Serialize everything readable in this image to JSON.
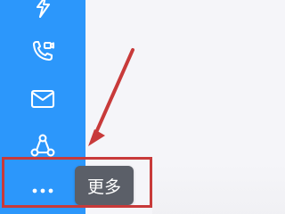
{
  "sidebar": {
    "background": "#2c97fb",
    "items": [
      {
        "icon": "power-icon"
      },
      {
        "icon": "video-call-icon"
      },
      {
        "icon": "mail-icon"
      },
      {
        "icon": "share-icon"
      }
    ],
    "more": {
      "icon": "more-dots-icon",
      "tooltip": "更多"
    }
  },
  "annotation": {
    "color": "#c83a3a"
  }
}
